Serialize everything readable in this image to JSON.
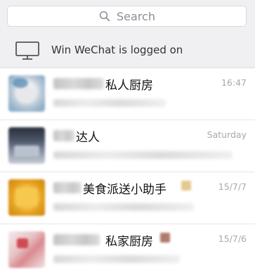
{
  "search": {
    "label": "Search",
    "icon": "search-icon"
  },
  "login_banner": {
    "icon": "monitor-icon",
    "text": "Win WeChat is logged on"
  },
  "chats": [
    {
      "name_visible": "私人厨房",
      "time": "16:47"
    },
    {
      "name_visible": "达人",
      "time": "Saturday"
    },
    {
      "name_visible": "美食派送小助手",
      "time": "15/7/7"
    },
    {
      "name_visible": "私家厨房",
      "time": "15/7/6"
    }
  ],
  "colors": {
    "background": "#ffffff",
    "search_bar_bg": "#f0f0f3",
    "muted_text": "#a8a8ad"
  }
}
